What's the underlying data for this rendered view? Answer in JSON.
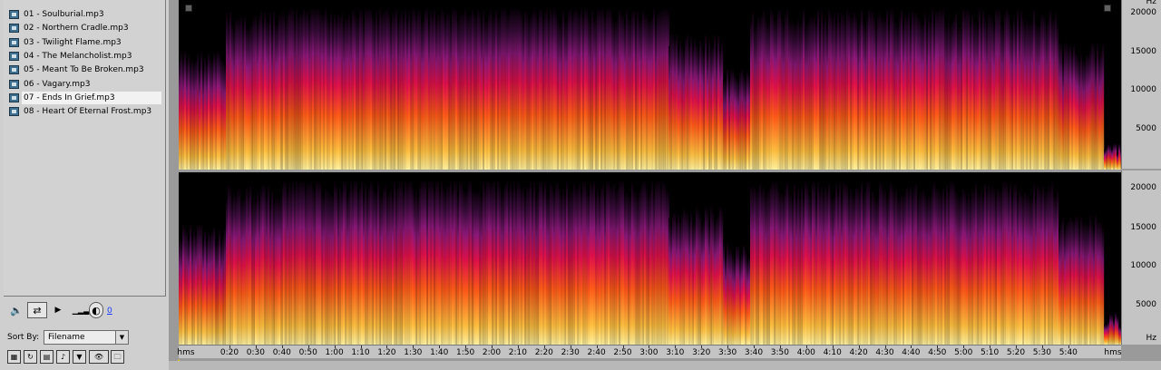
{
  "files": [
    {
      "label": "01 - Soulburial.mp3",
      "selected": false
    },
    {
      "label": "02 - Northern Cradle.mp3",
      "selected": false
    },
    {
      "label": "03 - Twilight Flame.mp3",
      "selected": false
    },
    {
      "label": "04 - The Melancholist.mp3",
      "selected": false
    },
    {
      "label": "05 - Meant To Be Broken.mp3",
      "selected": false
    },
    {
      "label": "06 - Vagary.mp3",
      "selected": false
    },
    {
      "label": "07 - Ends In Grief.mp3",
      "selected": true
    },
    {
      "label": "08 - Heart Of Eternal Frost.mp3",
      "selected": false
    }
  ],
  "transport": {
    "volume_value": "0"
  },
  "sort": {
    "label": "Sort By:",
    "value": "Filename"
  },
  "freq_ruler": {
    "unit": "Hz",
    "labels": [
      "20000",
      "15000",
      "10000",
      "5000"
    ]
  },
  "freq_ruler_bottom": {
    "labels": [
      "20000",
      "15000",
      "10000",
      "5000"
    ],
    "unit": "Hz"
  },
  "time_ruler": {
    "start": "hms",
    "end": "hms",
    "labels": [
      "0:20",
      "0:30",
      "0:40",
      "0:50",
      "1:00",
      "1:10",
      "1:20",
      "1:30",
      "1:40",
      "1:50",
      "2:00",
      "2:10",
      "2:20",
      "2:30",
      "2:40",
      "2:50",
      "3:00",
      "3:10",
      "3:20",
      "3:30",
      "3:40",
      "3:50",
      "4:00",
      "4:10",
      "4:20",
      "4:30",
      "4:40",
      "4:50",
      "5:00",
      "5:10",
      "5:20",
      "5:30",
      "5:40"
    ]
  },
  "colors": {
    "spectrum_low": "#ffe070",
    "spectrum_mid": "#ff2a10",
    "spectrum_high": "#7a1a7a",
    "background": "#000000"
  }
}
